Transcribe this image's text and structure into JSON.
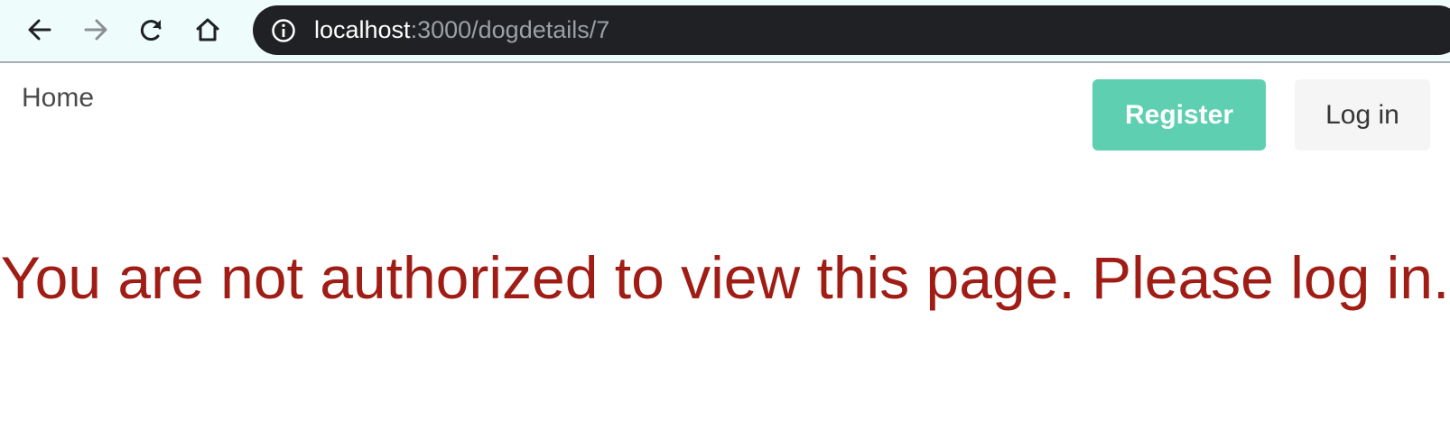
{
  "browser": {
    "url_host": "localhost",
    "url_path": ":3000/dogdetails/7",
    "icons": [
      "back-icon",
      "forward-icon",
      "reload-icon",
      "home-icon",
      "info-icon"
    ]
  },
  "nav": {
    "home_label": "Home",
    "register_label": "Register",
    "login_label": "Log in"
  },
  "main": {
    "message": "You are not authorized to view this page. Please log in."
  },
  "colors": {
    "register_bg": "#5ecfb1",
    "login_bg": "#f5f5f5",
    "message": "#a01d16",
    "address_bar_bg": "#202124"
  }
}
